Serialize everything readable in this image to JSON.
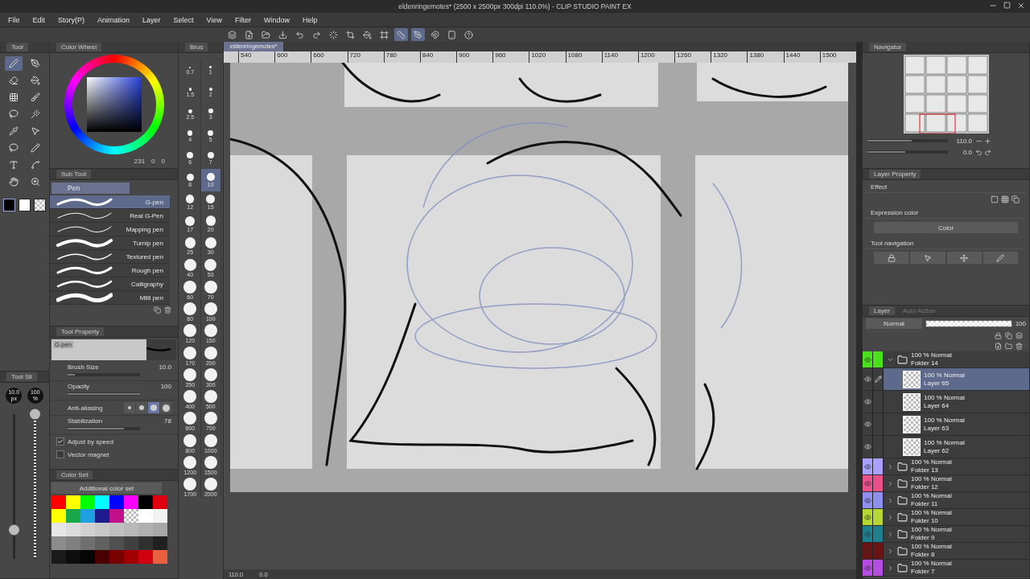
{
  "window": {
    "title": "eldenringemotes* (2500 x 2500px 300dpi 110.0%) - CLIP STUDIO PAINT EX"
  },
  "menu": [
    "File",
    "Edit",
    "Story(P)",
    "Animation",
    "Layer",
    "Select",
    "View",
    "Filter",
    "Window",
    "Help"
  ],
  "command_bar": [
    {
      "kind": "app",
      "on": false
    },
    {
      "kind": "new",
      "on": false
    },
    {
      "kind": "open",
      "on": false
    },
    {
      "kind": "save",
      "on": false
    },
    {
      "kind": "undo",
      "on": false
    },
    {
      "kind": "redo",
      "on": false
    },
    {
      "kind": "loading",
      "on": false
    },
    {
      "kind": "crop",
      "on": false
    },
    {
      "kind": "fill",
      "on": false
    },
    {
      "kind": "frame",
      "on": false
    },
    {
      "kind": "ruler",
      "on": true
    },
    {
      "kind": "ruler-pen",
      "on": true
    },
    {
      "kind": "snap",
      "on": false
    },
    {
      "kind": "device",
      "on": false
    },
    {
      "kind": "help",
      "on": false
    }
  ],
  "tool_palette": {
    "title": "Tool",
    "tools": [
      {
        "kind": "pen",
        "selected": true
      },
      {
        "kind": "pen-tool",
        "selected": false
      },
      {
        "kind": "eraser",
        "selected": false
      },
      {
        "kind": "bucket",
        "selected": false
      },
      {
        "kind": "grid",
        "selected": false
      },
      {
        "kind": "brush",
        "selected": false
      },
      {
        "kind": "lasso",
        "selected": false
      },
      {
        "kind": "wand",
        "selected": false
      },
      {
        "kind": "eyedropper",
        "selected": false
      },
      {
        "kind": "pointer",
        "selected": false
      },
      {
        "kind": "lasso",
        "selected": false
      },
      {
        "kind": "pencil",
        "selected": false
      },
      {
        "kind": "text",
        "selected": false
      },
      {
        "kind": "curve",
        "selected": false
      },
      {
        "kind": "hand",
        "selected": false
      },
      {
        "kind": "zoom",
        "selected": false
      }
    ],
    "colors": [
      {
        "kind": "solid",
        "color": "#000000",
        "selected": true
      },
      {
        "kind": "solid",
        "color": "#ffffff",
        "selected": false
      },
      {
        "kind": "transparent",
        "selected": false
      }
    ]
  },
  "color_wheel": {
    "title": "Color Wheel",
    "readout": [
      "231",
      "0",
      "0"
    ]
  },
  "brush_size": {
    "title": "Brus",
    "sizes": [
      {
        "label": "0.7",
        "selected": false
      },
      {
        "label": "1",
        "selected": false
      },
      {
        "label": "1.5",
        "selected": false
      },
      {
        "label": "2",
        "selected": false
      },
      {
        "label": "2.5",
        "selected": false
      },
      {
        "label": "3",
        "selected": false
      },
      {
        "label": "4",
        "selected": false
      },
      {
        "label": "5",
        "selected": false
      },
      {
        "label": "6",
        "selected": false
      },
      {
        "label": "7",
        "selected": false
      },
      {
        "label": "8",
        "selected": false
      },
      {
        "label": "10",
        "selected": true
      },
      {
        "label": "12",
        "selected": false
      },
      {
        "label": "15",
        "selected": false
      },
      {
        "label": "17",
        "selected": false
      },
      {
        "label": "20",
        "selected": false
      },
      {
        "label": "25",
        "selected": false
      },
      {
        "label": "30",
        "selected": false
      },
      {
        "label": "40",
        "selected": false
      },
      {
        "label": "50",
        "selected": false
      },
      {
        "label": "60",
        "selected": false
      },
      {
        "label": "70",
        "selected": false
      },
      {
        "label": "80",
        "selected": false
      },
      {
        "label": "100",
        "selected": false
      },
      {
        "label": "120",
        "selected": false
      },
      {
        "label": "150",
        "selected": false
      },
      {
        "label": "170",
        "selected": false
      },
      {
        "label": "200",
        "selected": false
      },
      {
        "label": "250",
        "selected": false
      },
      {
        "label": "300",
        "selected": false
      },
      {
        "label": "400",
        "selected": false
      },
      {
        "label": "500",
        "selected": false
      },
      {
        "label": "600",
        "selected": false
      },
      {
        "label": "700",
        "selected": false
      },
      {
        "label": "800",
        "selected": false
      },
      {
        "label": "1000",
        "selected": false
      },
      {
        "label": "1200",
        "selected": false
      },
      {
        "label": "1500",
        "selected": false
      },
      {
        "label": "1700",
        "selected": false
      },
      {
        "label": "2000",
        "selected": false
      }
    ]
  },
  "sub_tool": {
    "title": "Sub Tool",
    "group": "Pen",
    "items": [
      {
        "label": "G-pen",
        "selected": true
      },
      {
        "label": "Real G-Pen",
        "selected": false
      },
      {
        "label": "Mapping pen",
        "selected": false
      },
      {
        "label": "Turnip pen",
        "selected": false
      },
      {
        "label": "Textured pen",
        "selected": false
      },
      {
        "label": "Rough pen",
        "selected": false
      },
      {
        "label": "Calligraphy",
        "selected": false
      },
      {
        "label": "Milli pen",
        "selected": false
      }
    ]
  },
  "tool_property": {
    "title": "Tool Property",
    "preview_label": "G-pen",
    "sliders": [
      {
        "label": "Brush Size",
        "value": "10.0",
        "level": 0.1
      },
      {
        "label": "Opacity",
        "value": "100",
        "level": 1
      }
    ],
    "anti_aliasing": {
      "label": "Anti-aliasing",
      "options": [
        {
          "kind": "none",
          "selected": false
        },
        {
          "kind": "weak",
          "selected": false
        },
        {
          "kind": "medium",
          "selected": true
        },
        {
          "kind": "strong",
          "selected": false
        }
      ]
    },
    "stabilization": {
      "label": "Stabilization",
      "value": "78",
      "level": 0.78
    },
    "checks": [
      {
        "label": "Adjust by speed",
        "checked": true
      },
      {
        "label": "Vector magnet",
        "checked": false
      }
    ]
  },
  "tool_slider": {
    "title": "Tool Sli",
    "size": {
      "value": "10.0",
      "unit": "px",
      "level": 0.2
    },
    "opacity": {
      "value": "100",
      "unit": "%",
      "level": 1
    }
  },
  "color_set": {
    "title": "Color Set",
    "set_name": "Additional color set",
    "swatches": [
      {
        "kind": "solid",
        "color": "#ff0000"
      },
      {
        "kind": "solid",
        "color": "#ffff00"
      },
      {
        "kind": "solid",
        "color": "#00ff00"
      },
      {
        "kind": "solid",
        "color": "#00ffff"
      },
      {
        "kind": "solid",
        "color": "#0000ff"
      },
      {
        "kind": "solid",
        "color": "#ff00ff"
      },
      {
        "kind": "solid",
        "color": "#000000"
      },
      {
        "kind": "solid",
        "color": "#e00010"
      },
      {
        "kind": "solid",
        "color": "#ffff00"
      },
      {
        "kind": "solid",
        "color": "#1aa84a"
      },
      {
        "kind": "solid",
        "color": "#1ea0e0"
      },
      {
        "kind": "solid",
        "color": "#1c1c8c"
      },
      {
        "kind": "solid",
        "color": "#c0108a"
      },
      {
        "kind": "transparent"
      },
      {
        "kind": "solid",
        "color": "#ffffff"
      },
      {
        "kind": "solid",
        "color": "#f2f2f2"
      },
      {
        "kind": "solid",
        "color": "#e6e6e6"
      },
      {
        "kind": "solid",
        "color": "#dcdcdc"
      },
      {
        "kind": "solid",
        "color": "#d0d0d0"
      },
      {
        "kind": "solid",
        "color": "#c8c8c8"
      },
      {
        "kind": "solid",
        "color": "#c0c0c0"
      },
      {
        "kind": "solid",
        "color": "#b8b8b8"
      },
      {
        "kind": "solid",
        "color": "#b0b0b0"
      },
      {
        "kind": "solid",
        "color": "#a8a8a8"
      },
      {
        "kind": "solid",
        "color": "#8c8c8c"
      },
      {
        "kind": "solid",
        "color": "#808080"
      },
      {
        "kind": "solid",
        "color": "#707070"
      },
      {
        "kind": "solid",
        "color": "#606060"
      },
      {
        "kind": "solid",
        "color": "#505050"
      },
      {
        "kind": "solid",
        "color": "#404040"
      },
      {
        "kind": "solid",
        "color": "#303030"
      },
      {
        "kind": "solid",
        "color": "#202020"
      },
      {
        "kind": "solid",
        "color": "#1a1a1a"
      },
      {
        "kind": "solid",
        "color": "#0e0e0e"
      },
      {
        "kind": "solid",
        "color": "#050505"
      },
      {
        "kind": "solid",
        "color": "#4a0000"
      },
      {
        "kind": "solid",
        "color": "#780000"
      },
      {
        "kind": "solid",
        "color": "#a00000"
      },
      {
        "kind": "solid",
        "color": "#d00010"
      },
      {
        "kind": "solid",
        "color": "#e86040"
      }
    ]
  },
  "canvas": {
    "tab": "eldenringemotes*",
    "ruler": [
      "540",
      "600",
      "660",
      "720",
      "780",
      "840",
      "900",
      "960",
      "1020",
      "1080",
      "1140",
      "1200",
      "1260",
      "1320",
      "1380",
      "1440",
      "1500"
    ],
    "zoom": "110.0",
    "angle": "0.0"
  },
  "navigator": {
    "title": "Navigator",
    "zoom": {
      "value": "110.0",
      "level": 0.55
    },
    "rotate": {
      "value": "0.0",
      "level": 0.47
    }
  },
  "layer_property": {
    "title": "Layer Property",
    "effect": "Effect",
    "expression_color": {
      "label": "Expression color",
      "value": "Color"
    },
    "tool_navigation": "Tool navigation"
  },
  "layers_panel": {
    "tabs": [
      {
        "label": "Layer",
        "selected": true
      },
      {
        "label": "Auto Action",
        "selected": false
      }
    ],
    "blend_mode": "Normal",
    "opacity": {
      "value": "100",
      "level": 1
    },
    "layers": [
      {
        "kind": "folder",
        "name": "Folder 14",
        "mode": "100 % Normal",
        "color": "#4be01c",
        "expanded": true,
        "selected": false,
        "children": [
          {
            "kind": "raster",
            "name": "Layer 65",
            "mode": "100 % Normal",
            "selected": true
          },
          {
            "kind": "raster",
            "name": "Layer 64",
            "mode": "100 % Normal",
            "selected": false
          },
          {
            "kind": "raster",
            "name": "Layer 63",
            "mode": "100 % Normal",
            "selected": false
          },
          {
            "kind": "raster",
            "name": "Layer 62",
            "mode": "100 % Normal",
            "selected": false
          }
        ]
      },
      {
        "kind": "folder",
        "name": "Folder 13",
        "mode": "100 % Normal",
        "color": "#a9a0ff",
        "expanded": false,
        "selected": false
      },
      {
        "kind": "folder",
        "name": "Folder 12",
        "mode": "100 % Normal",
        "color": "#e8508a",
        "expanded": false,
        "selected": false
      },
      {
        "kind": "folder",
        "name": "Folder 11",
        "mode": "100 % Normal",
        "color": "#8f8ff0",
        "expanded": false,
        "selected": false
      },
      {
        "kind": "folder",
        "name": "Folder 10",
        "mode": "100 % Normal",
        "color": "#b5d633",
        "expanded": false,
        "selected": false
      },
      {
        "kind": "folder",
        "name": "Folder 9",
        "mode": "100 % Normal",
        "color": "#1f7f8f",
        "expanded": false,
        "selected": false
      },
      {
        "kind": "folder",
        "name": "Folder 8",
        "mode": "100 % Normal",
        "color": "#6a1414",
        "expanded": false,
        "selected": false
      },
      {
        "kind": "folder",
        "name": "Folder 7",
        "mode": "100 % Normal",
        "color": "#b44de0",
        "expanded": false,
        "selected": false
      }
    ]
  }
}
